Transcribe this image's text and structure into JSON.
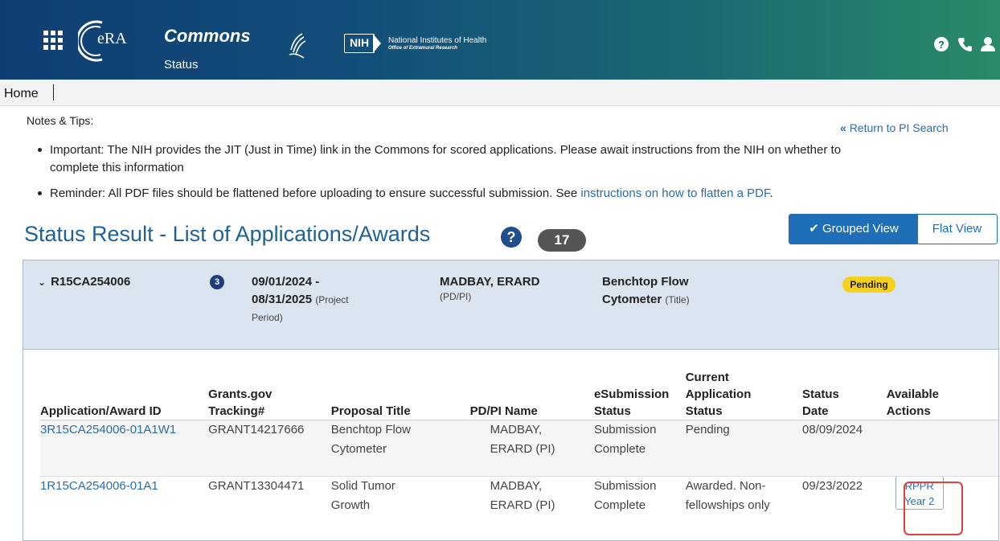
{
  "header": {
    "logo_text": "eRA",
    "app_title": "Commons",
    "app_subtitle": "Status",
    "nih_abbr": "NIH",
    "nih_name": "National Institutes of Health",
    "nih_office": "Office of Extramural Research",
    "icons": [
      "grid-icon",
      "help-icon",
      "phone-icon",
      "user-icon"
    ]
  },
  "breadcrumb": {
    "home": "Home"
  },
  "notes": {
    "title": "Notes & Tips:",
    "return_link": "Return to PI Search",
    "bullet1_line1": "Important: The NIH provides the JIT (Just in Time) link in the Commons for scored applications. Please await instructions from the NIH on whether to",
    "bullet1_line2": "complete this information",
    "bullet2_text": "Reminder: All PDF files should be flattened before uploading to ensure successful submission. See ",
    "bullet2_link": "instructions on how to flatten a PDF",
    "bullet2_end": "."
  },
  "results": {
    "title": "Status Result - List of Applications/Awards",
    "count": "17",
    "grouped_view": "Grouped View",
    "flat_view": "Flat View"
  },
  "group": {
    "id": "R15CA254006",
    "count": "3",
    "period_start": "09/01/2024 -",
    "period_end": "08/31/2025",
    "period_label1": "(Project",
    "period_label2": "Period)",
    "pi_name": "MADBAY, ERARD",
    "pi_label": "(PD/PI)",
    "title_line1": "Benchtop Flow",
    "title_line2": "Cytometer",
    "title_label": "(Title)",
    "status": "Pending"
  },
  "table": {
    "headers": {
      "app_id": "Application/Award ID",
      "grants1": "Grants.gov",
      "grants2": "Tracking#",
      "proposal": "Proposal Title",
      "pdpi": "PD/PI Name",
      "esub1": "eSubmission",
      "esub2": "Status",
      "cur1": "Current",
      "cur2": "Application",
      "cur3": "Status",
      "sdate1": "Status",
      "sdate2": "Date",
      "avail1": "Available",
      "avail2": "Actions"
    },
    "rows": [
      {
        "app_id": "3R15CA254006-01A1W1",
        "tracking": "GRANT14217666",
        "title1": "Benchtop Flow",
        "title2": "Cytometer",
        "pi1": "MADBAY,",
        "pi2": "ERARD (PI)",
        "esub1": "Submission",
        "esub2": "Complete",
        "status1": "Pending",
        "status2": "",
        "date": "08/09/2024"
      },
      {
        "app_id": "1R15CA254006-01A1",
        "tracking": "GRANT13304471",
        "title1": "Solid Tumor",
        "title2": "Growth",
        "pi1": "MADBAY,",
        "pi2": "ERARD (PI)",
        "esub1": "Submission",
        "esub2": "Complete",
        "status1": "Awarded. Non-",
        "status2": "fellowships only",
        "date": "09/23/2022",
        "action1": "RPPR",
        "action2": "Year 2"
      }
    ]
  },
  "colors": {
    "header_start": "#0f3d73",
    "header_end": "#2a8a68",
    "link": "#2a6ea8",
    "title": "#1f6396",
    "toggle_active": "#1f6fb8",
    "pending_badge": "#f5d020",
    "highlight": "#e04040"
  }
}
